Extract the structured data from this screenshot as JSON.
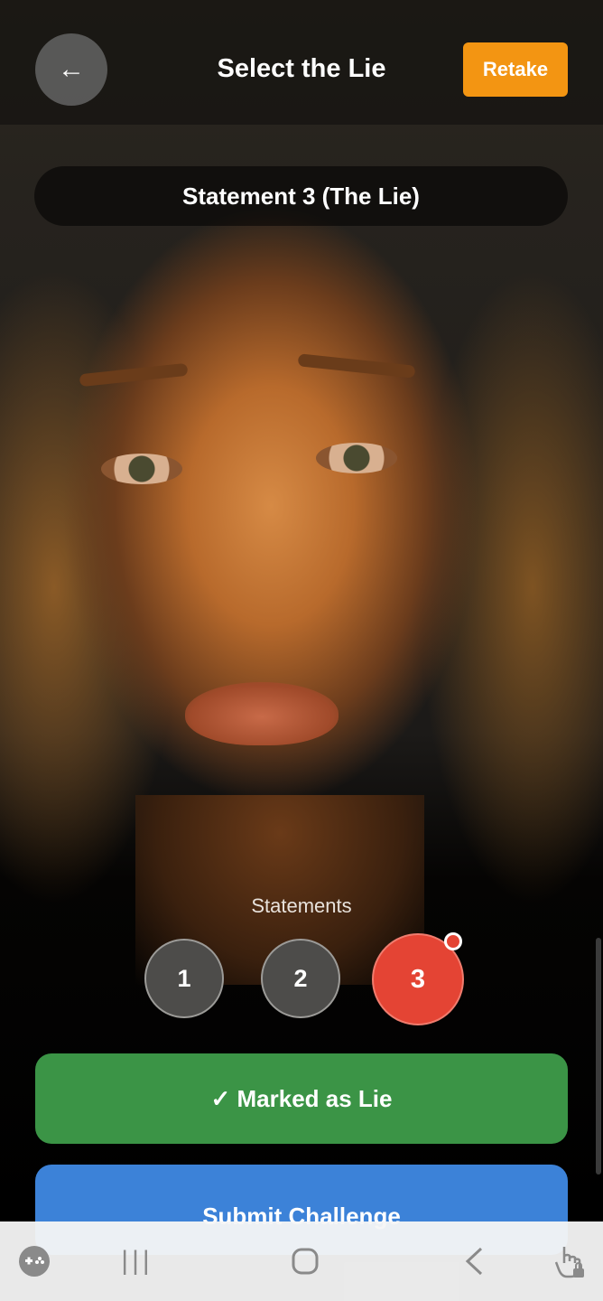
{
  "header": {
    "back_icon": "←",
    "title": "Select the Lie",
    "retake_label": "Retake"
  },
  "video": {
    "statement_label": "Statement 3 (The Lie)"
  },
  "statements": {
    "label": "Statements",
    "items": [
      "1",
      "2",
      "3"
    ],
    "selected": "3"
  },
  "actions": {
    "marked_label": "✓ Marked as Lie",
    "submit_label": "Submit Challenge"
  },
  "system_nav": {
    "recent_icon": "|||",
    "back_icon": "<"
  },
  "colors": {
    "accent_orange": "#f39512",
    "lie_red": "#e44434",
    "marked_green": "#3b9446",
    "submit_blue": "#3c82d8"
  }
}
